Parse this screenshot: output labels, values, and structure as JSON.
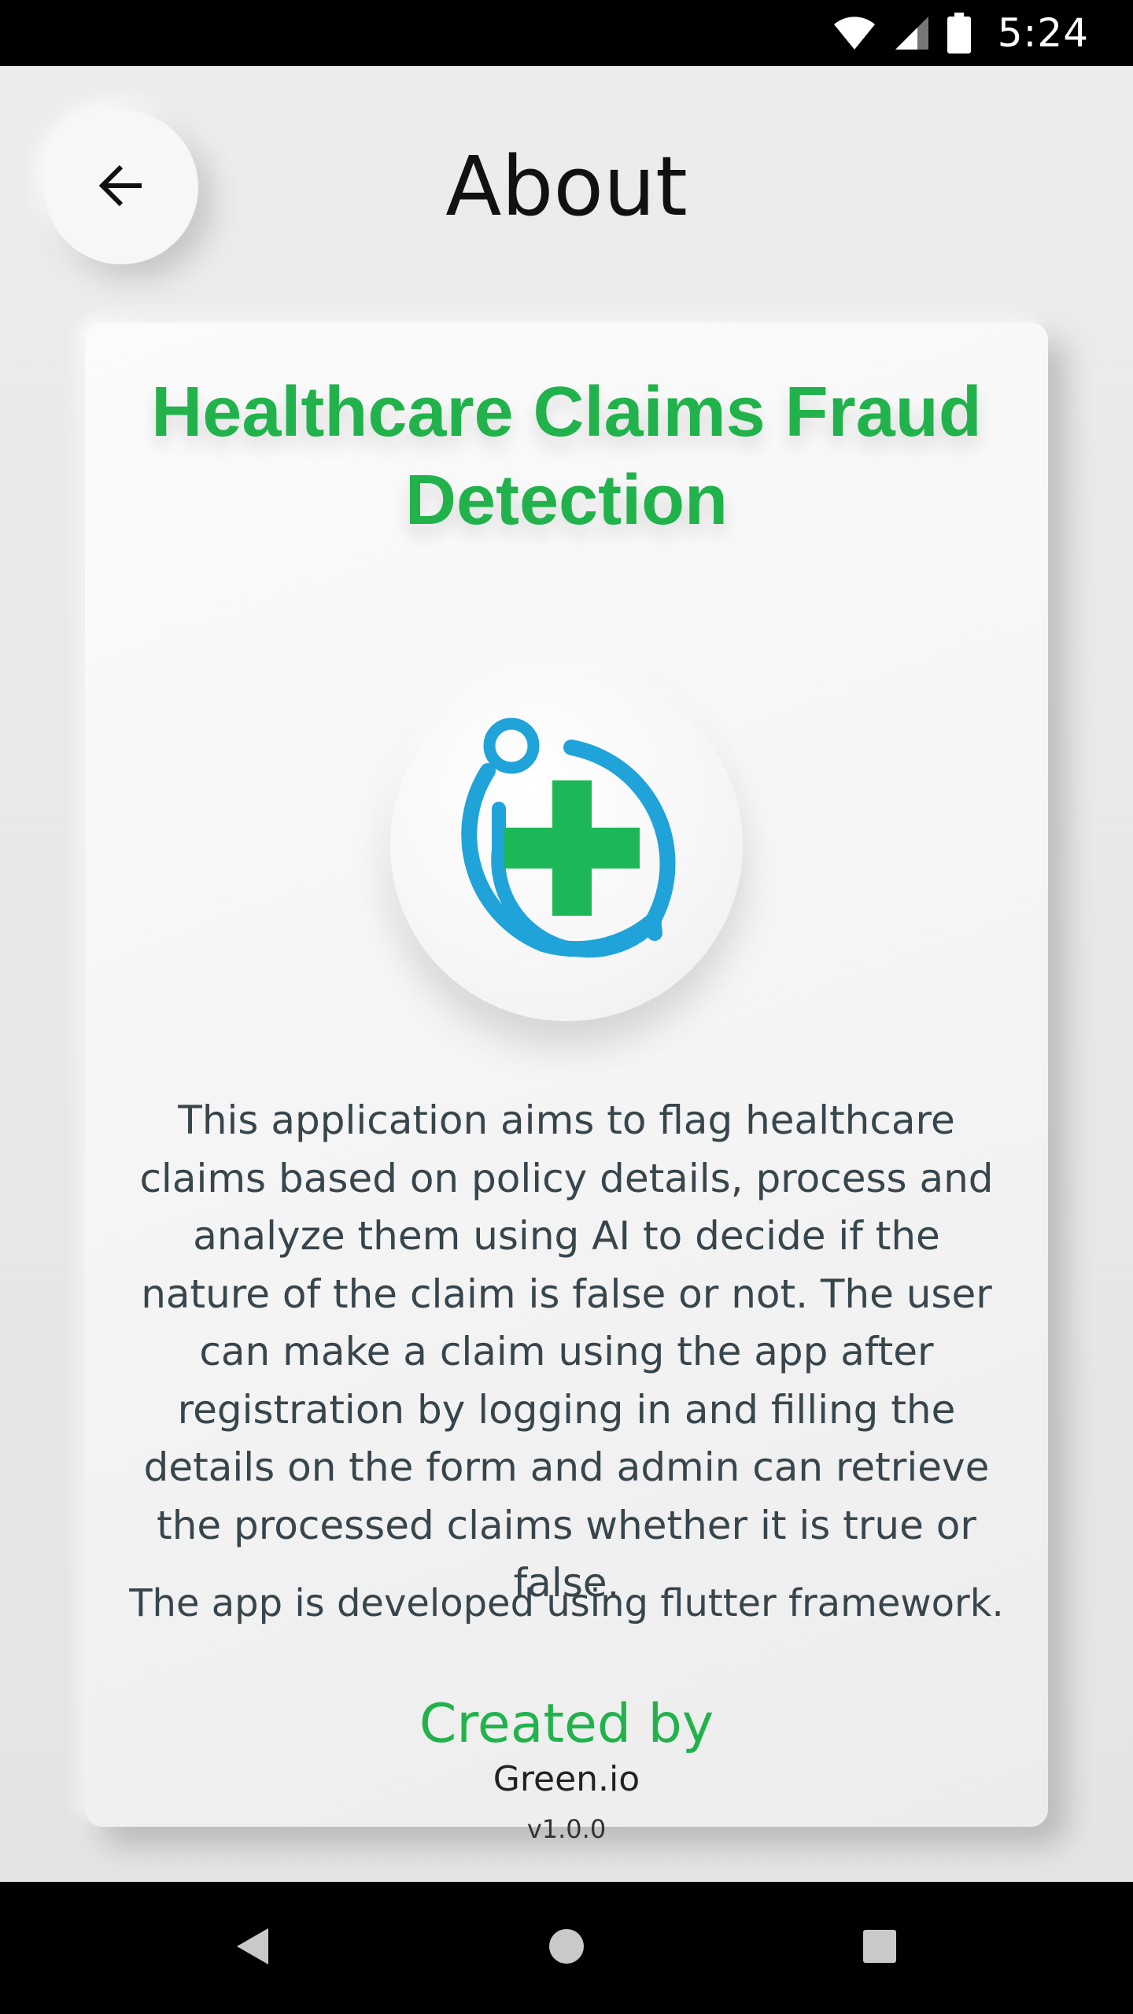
{
  "status_bar": {
    "time": "5:24",
    "icons": [
      "wifi-icon",
      "signal-icon",
      "battery-icon"
    ]
  },
  "header": {
    "title": "About",
    "back_icon": "arrow-left-icon"
  },
  "card": {
    "app_title": "Healthcare Claims Fraud Detection",
    "logo_icon": "medical-cross-stethoscope-logo",
    "description": "This application aims to flag healthcare claims based on policy details, process and analyze them using AI to decide if the nature of the claim is false or not. The user can make a claim using the app after registration by logging in and filling the details on the form and admin can retrieve the processed claims whether it is true or false.",
    "framework_note": "The app is developed using flutter framework.",
    "created_by_label": "Created by",
    "creator_name": "Green.io",
    "version": "v1.0.0"
  },
  "colors": {
    "accent_green": "#22b24c",
    "logo_blue": "#1fa3d9",
    "cross_green": "#1cb857",
    "body_text": "#37454d"
  },
  "nav_bar": {
    "icons": [
      "nav-back-icon",
      "nav-home-icon",
      "nav-recents-icon"
    ]
  }
}
